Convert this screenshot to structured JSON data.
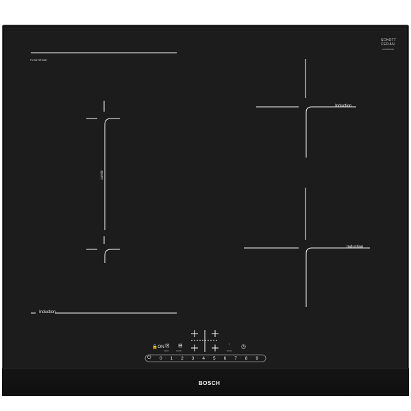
{
  "panel": {
    "model_code": "PVS675FB5E",
    "logo_line1": "SCHOTT",
    "logo_line2": "CERAN",
    "logo_line3": "1003508F08",
    "brand": "BOSCH"
  },
  "zones": {
    "left_combi_vertical_label": "combi",
    "right_top_label": "Induction",
    "right_bottom_label": "Induction",
    "bottom_left_label": "Induction"
  },
  "controls": {
    "power_symbol": "⏻",
    "lock_label": "🔒ON",
    "move_label": "move",
    "combi_label": "combi",
    "boost_label": "boost",
    "timer_symbol": "◷",
    "slider_values": [
      "0",
      "1",
      "2",
      "3",
      "4",
      "5",
      "6",
      "7",
      "8",
      "9"
    ]
  }
}
